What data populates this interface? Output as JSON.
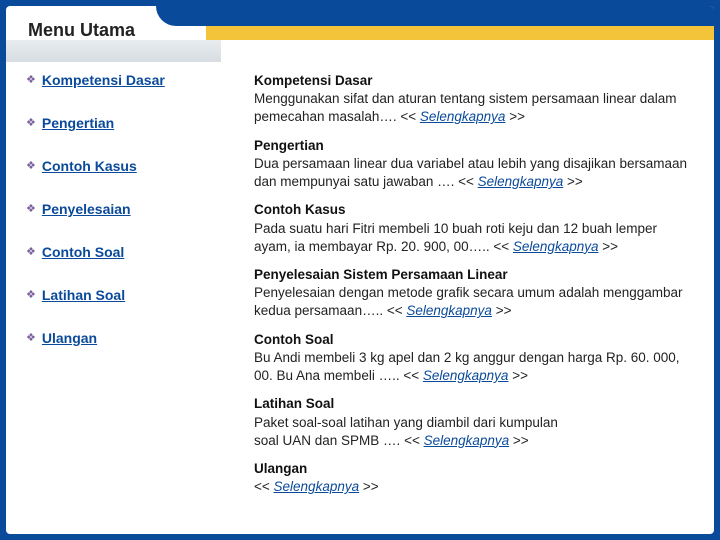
{
  "header": {
    "title": "Menu Utama"
  },
  "sidebar": {
    "items": [
      {
        "label": "Kompetensi Dasar"
      },
      {
        "label": "Pengertian"
      },
      {
        "label": "Contoh Kasus"
      },
      {
        "label": "Penyelesaian"
      },
      {
        "label": "Contoh Soal"
      },
      {
        "label": "Latihan Soal"
      },
      {
        "label": "Ulangan"
      }
    ]
  },
  "common": {
    "more_open": "<< ",
    "more_label": "Selengkapnya",
    "more_close": " >>"
  },
  "sections": [
    {
      "heading": "Kompetensi Dasar",
      "body": "Menggunakan sifat dan aturan tentang sistem persamaan linear dalam pemecahan masalah…. "
    },
    {
      "heading": "Pengertian",
      "body": "Dua persamaan linear dua variabel atau lebih yang disajikan bersamaan dan mempunyai satu jawaban …. "
    },
    {
      "heading": "Contoh Kasus",
      "body": "Pada suatu  hari Fitri membeli 10 buah roti keju dan 12 buah lemper ayam, ia membayar Rp. 20. 900, 00….. "
    },
    {
      "heading": "Penyelesaian Sistem Persamaan Linear",
      "body": "Penyelesaian dengan metode grafik secara umum adalah menggambar kedua persamaan….. "
    },
    {
      "heading": "Contoh Soal",
      "body": "Bu Andi membeli 3 kg apel dan 2 kg anggur dengan harga Rp. 60. 000, 00. Bu Ana membeli ….. "
    },
    {
      "heading": "Latihan Soal",
      "body_line1": "Paket soal-soal latihan yang diambil dari kumpulan",
      "body_line2": "soal UAN dan SPMB …. "
    },
    {
      "heading": "Ulangan",
      "body": ""
    }
  ]
}
